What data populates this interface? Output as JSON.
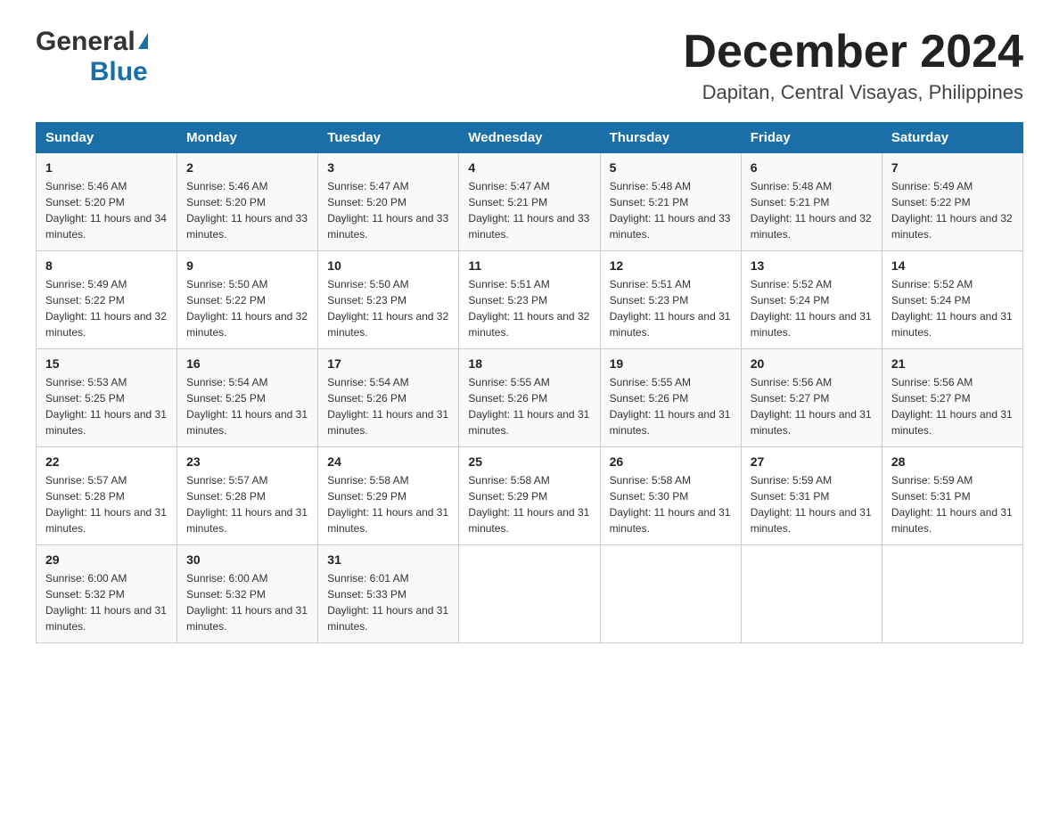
{
  "header": {
    "logo": {
      "general": "General",
      "blue": "Blue",
      "triangle": "▲"
    },
    "title": "December 2024",
    "location": "Dapitan, Central Visayas, Philippines"
  },
  "calendar": {
    "days_of_week": [
      "Sunday",
      "Monday",
      "Tuesday",
      "Wednesday",
      "Thursday",
      "Friday",
      "Saturday"
    ],
    "weeks": [
      [
        {
          "day": "1",
          "sunrise": "5:46 AM",
          "sunset": "5:20 PM",
          "daylight": "11 hours and 34 minutes."
        },
        {
          "day": "2",
          "sunrise": "5:46 AM",
          "sunset": "5:20 PM",
          "daylight": "11 hours and 33 minutes."
        },
        {
          "day": "3",
          "sunrise": "5:47 AM",
          "sunset": "5:20 PM",
          "daylight": "11 hours and 33 minutes."
        },
        {
          "day": "4",
          "sunrise": "5:47 AM",
          "sunset": "5:21 PM",
          "daylight": "11 hours and 33 minutes."
        },
        {
          "day": "5",
          "sunrise": "5:48 AM",
          "sunset": "5:21 PM",
          "daylight": "11 hours and 33 minutes."
        },
        {
          "day": "6",
          "sunrise": "5:48 AM",
          "sunset": "5:21 PM",
          "daylight": "11 hours and 32 minutes."
        },
        {
          "day": "7",
          "sunrise": "5:49 AM",
          "sunset": "5:22 PM",
          "daylight": "11 hours and 32 minutes."
        }
      ],
      [
        {
          "day": "8",
          "sunrise": "5:49 AM",
          "sunset": "5:22 PM",
          "daylight": "11 hours and 32 minutes."
        },
        {
          "day": "9",
          "sunrise": "5:50 AM",
          "sunset": "5:22 PM",
          "daylight": "11 hours and 32 minutes."
        },
        {
          "day": "10",
          "sunrise": "5:50 AM",
          "sunset": "5:23 PM",
          "daylight": "11 hours and 32 minutes."
        },
        {
          "day": "11",
          "sunrise": "5:51 AM",
          "sunset": "5:23 PM",
          "daylight": "11 hours and 32 minutes."
        },
        {
          "day": "12",
          "sunrise": "5:51 AM",
          "sunset": "5:23 PM",
          "daylight": "11 hours and 31 minutes."
        },
        {
          "day": "13",
          "sunrise": "5:52 AM",
          "sunset": "5:24 PM",
          "daylight": "11 hours and 31 minutes."
        },
        {
          "day": "14",
          "sunrise": "5:52 AM",
          "sunset": "5:24 PM",
          "daylight": "11 hours and 31 minutes."
        }
      ],
      [
        {
          "day": "15",
          "sunrise": "5:53 AM",
          "sunset": "5:25 PM",
          "daylight": "11 hours and 31 minutes."
        },
        {
          "day": "16",
          "sunrise": "5:54 AM",
          "sunset": "5:25 PM",
          "daylight": "11 hours and 31 minutes."
        },
        {
          "day": "17",
          "sunrise": "5:54 AM",
          "sunset": "5:26 PM",
          "daylight": "11 hours and 31 minutes."
        },
        {
          "day": "18",
          "sunrise": "5:55 AM",
          "sunset": "5:26 PM",
          "daylight": "11 hours and 31 minutes."
        },
        {
          "day": "19",
          "sunrise": "5:55 AM",
          "sunset": "5:26 PM",
          "daylight": "11 hours and 31 minutes."
        },
        {
          "day": "20",
          "sunrise": "5:56 AM",
          "sunset": "5:27 PM",
          "daylight": "11 hours and 31 minutes."
        },
        {
          "day": "21",
          "sunrise": "5:56 AM",
          "sunset": "5:27 PM",
          "daylight": "11 hours and 31 minutes."
        }
      ],
      [
        {
          "day": "22",
          "sunrise": "5:57 AM",
          "sunset": "5:28 PM",
          "daylight": "11 hours and 31 minutes."
        },
        {
          "day": "23",
          "sunrise": "5:57 AM",
          "sunset": "5:28 PM",
          "daylight": "11 hours and 31 minutes."
        },
        {
          "day": "24",
          "sunrise": "5:58 AM",
          "sunset": "5:29 PM",
          "daylight": "11 hours and 31 minutes."
        },
        {
          "day": "25",
          "sunrise": "5:58 AM",
          "sunset": "5:29 PM",
          "daylight": "11 hours and 31 minutes."
        },
        {
          "day": "26",
          "sunrise": "5:58 AM",
          "sunset": "5:30 PM",
          "daylight": "11 hours and 31 minutes."
        },
        {
          "day": "27",
          "sunrise": "5:59 AM",
          "sunset": "5:31 PM",
          "daylight": "11 hours and 31 minutes."
        },
        {
          "day": "28",
          "sunrise": "5:59 AM",
          "sunset": "5:31 PM",
          "daylight": "11 hours and 31 minutes."
        }
      ],
      [
        {
          "day": "29",
          "sunrise": "6:00 AM",
          "sunset": "5:32 PM",
          "daylight": "11 hours and 31 minutes."
        },
        {
          "day": "30",
          "sunrise": "6:00 AM",
          "sunset": "5:32 PM",
          "daylight": "11 hours and 31 minutes."
        },
        {
          "day": "31",
          "sunrise": "6:01 AM",
          "sunset": "5:33 PM",
          "daylight": "11 hours and 31 minutes."
        },
        null,
        null,
        null,
        null
      ]
    ],
    "sunrise_label": "Sunrise:",
    "sunset_label": "Sunset:",
    "daylight_label": "Daylight:"
  }
}
